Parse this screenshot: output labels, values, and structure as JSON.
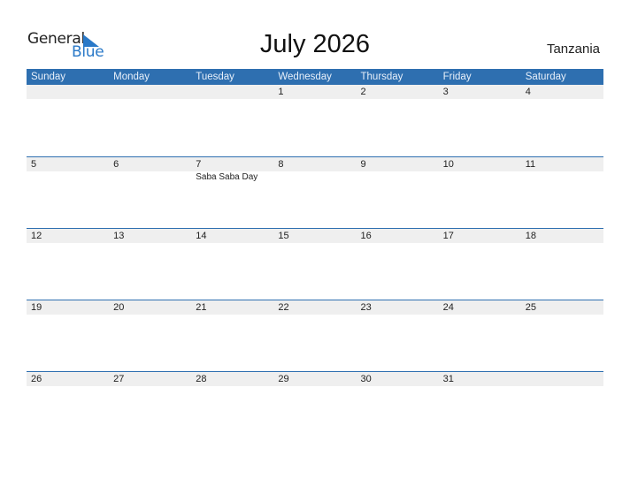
{
  "logo": {
    "text_general": "General",
    "text_blue": "Blue"
  },
  "title": "July 2026",
  "country": "Tanzania",
  "colors": {
    "header_bg": "#2e6fb0",
    "accent": "#2a79c8",
    "daynum_bg": "#efefef"
  },
  "weekdays": [
    "Sunday",
    "Monday",
    "Tuesday",
    "Wednesday",
    "Thursday",
    "Friday",
    "Saturday"
  ],
  "weeks": [
    {
      "days": [
        "",
        "",
        "",
        "1",
        "2",
        "3",
        "4"
      ],
      "events": [
        "",
        "",
        "",
        "",
        "",
        "",
        ""
      ]
    },
    {
      "days": [
        "5",
        "6",
        "7",
        "8",
        "9",
        "10",
        "11"
      ],
      "events": [
        "",
        "",
        "Saba Saba Day",
        "",
        "",
        "",
        ""
      ]
    },
    {
      "days": [
        "12",
        "13",
        "14",
        "15",
        "16",
        "17",
        "18"
      ],
      "events": [
        "",
        "",
        "",
        "",
        "",
        "",
        ""
      ]
    },
    {
      "days": [
        "19",
        "20",
        "21",
        "22",
        "23",
        "24",
        "25"
      ],
      "events": [
        "",
        "",
        "",
        "",
        "",
        "",
        ""
      ]
    },
    {
      "days": [
        "26",
        "27",
        "28",
        "29",
        "30",
        "31",
        ""
      ],
      "events": [
        "",
        "",
        "",
        "",
        "",
        "",
        ""
      ]
    }
  ]
}
